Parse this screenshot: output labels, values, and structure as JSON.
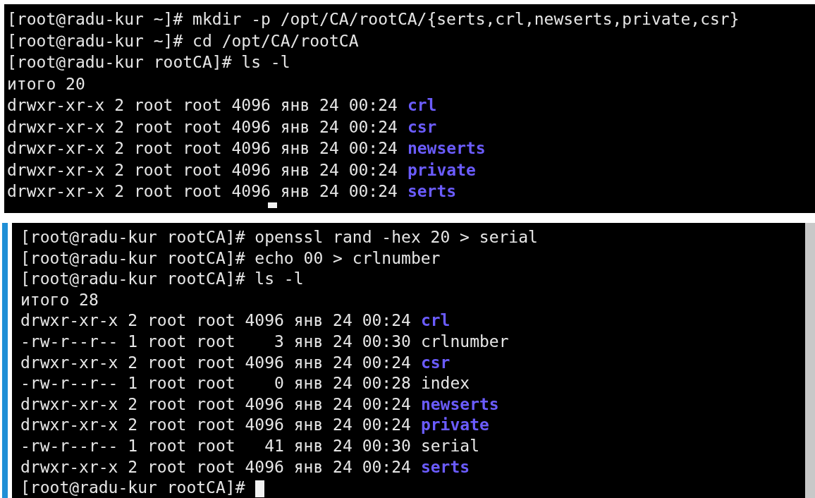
{
  "terminals": [
    {
      "lines": [
        {
          "kind": "text",
          "text": "[root@radu-kur ~]# mkdir -p /opt/CA/rootCA/{serts,crl,newserts,private,csr}"
        },
        {
          "kind": "text",
          "text": "[root@radu-kur ~]# cd /opt/CA/rootCA"
        },
        {
          "kind": "text",
          "text": "[root@radu-kur rootCA]# ls -l"
        },
        {
          "kind": "text",
          "text": "итого 20"
        },
        {
          "kind": "entry",
          "meta": "drwxr-xr-x 2 root root 4096 янв 24 00:24",
          "name": "crl",
          "is_dir": true
        },
        {
          "kind": "entry",
          "meta": "drwxr-xr-x 2 root root 4096 янв 24 00:24",
          "name": "csr",
          "is_dir": true
        },
        {
          "kind": "entry",
          "meta": "drwxr-xr-x 2 root root 4096 янв 24 00:24",
          "name": "newserts",
          "is_dir": true
        },
        {
          "kind": "entry",
          "meta": "drwxr-xr-x 2 root root 4096 янв 24 00:24",
          "name": "private",
          "is_dir": true
        },
        {
          "kind": "entry",
          "meta": "drwxr-xr-x 2 root root 4096 янв 24 00:24",
          "name": "serts",
          "is_dir": true
        },
        {
          "kind": "cursor"
        }
      ]
    },
    {
      "lines": [
        {
          "kind": "text",
          "text": "[root@radu-kur rootCA]# openssl rand -hex 20 > serial"
        },
        {
          "kind": "text",
          "text": "[root@radu-kur rootCA]# echo 00 > crlnumber"
        },
        {
          "kind": "text",
          "text": "[root@radu-kur rootCA]# ls -l"
        },
        {
          "kind": "text",
          "text": "итого 28"
        },
        {
          "kind": "entry",
          "meta": "drwxr-xr-x 2 root root 4096 янв 24 00:24",
          "name": "crl",
          "is_dir": true
        },
        {
          "kind": "entry",
          "meta": "-rw-r--r-- 1 root root    3 янв 24 00:30",
          "name": "crlnumber",
          "is_dir": false
        },
        {
          "kind": "entry",
          "meta": "drwxr-xr-x 2 root root 4096 янв 24 00:24",
          "name": "csr",
          "is_dir": true
        },
        {
          "kind": "entry",
          "meta": "-rw-r--r-- 1 root root    0 янв 24 00:28",
          "name": "index",
          "is_dir": false
        },
        {
          "kind": "entry",
          "meta": "drwxr-xr-x 2 root root 4096 янв 24 00:24",
          "name": "newserts",
          "is_dir": true
        },
        {
          "kind": "entry",
          "meta": "drwxr-xr-x 2 root root 4096 янв 24 00:24",
          "name": "private",
          "is_dir": true
        },
        {
          "kind": "entry",
          "meta": "-rw-r--r-- 1 root root   41 янв 24 00:30",
          "name": "serial",
          "is_dir": false
        },
        {
          "kind": "entry",
          "meta": "drwxr-xr-x 2 root root 4096 янв 24 00:24",
          "name": "serts",
          "is_dir": true
        },
        {
          "kind": "prompt",
          "text": "[root@radu-kur rootCA]#"
        }
      ]
    }
  ]
}
